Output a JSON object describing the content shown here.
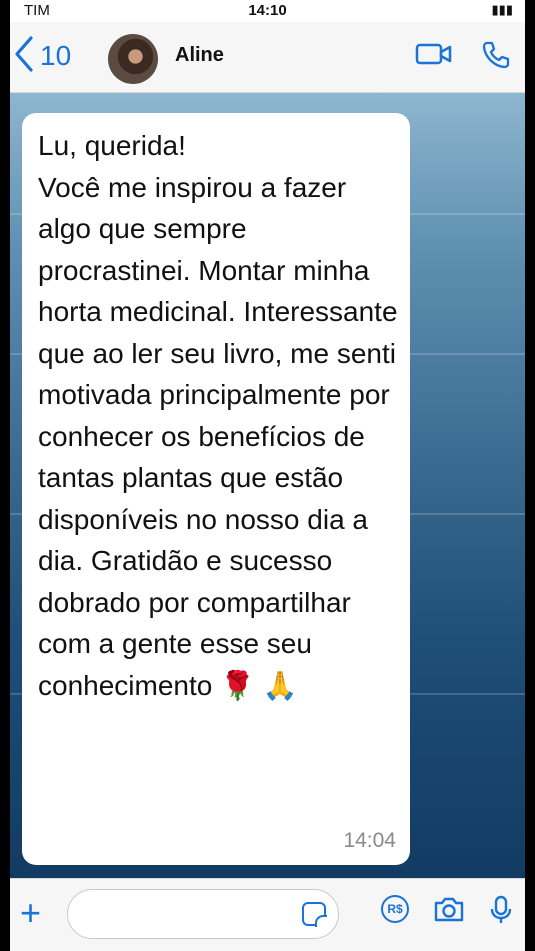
{
  "status": {
    "carrier": "TIM",
    "time": "14:10"
  },
  "header": {
    "back_count": "10",
    "contact_name": "Aline"
  },
  "message": {
    "text": "Lu, querida!\nVocê  me inspirou a fazer algo que sempre procrastinei. Montar minha  horta medicinal. Interessante que ao ler seu livro, me senti motivada principalmente por conhecer os benefícios de tantas plantas que estão disponíveis no nosso dia a dia. Gratidão e sucesso dobrado por compartilhar com a gente esse seu conhecimento 🌹 🙏",
    "timestamp": "14:04"
  },
  "input": {
    "placeholder": ""
  },
  "icons": {
    "back": "chevron-left-icon",
    "video": "video-call-icon",
    "phone": "phone-icon",
    "add": "plus-icon",
    "sticker": "sticker-icon",
    "payment": "payment-icon",
    "camera": "camera-icon",
    "mic": "microphone-icon"
  },
  "colors": {
    "accent": "#1a73d9",
    "bubble": "#ffffff",
    "timestamp": "#8a8a8a"
  },
  "payment_label": "R$"
}
